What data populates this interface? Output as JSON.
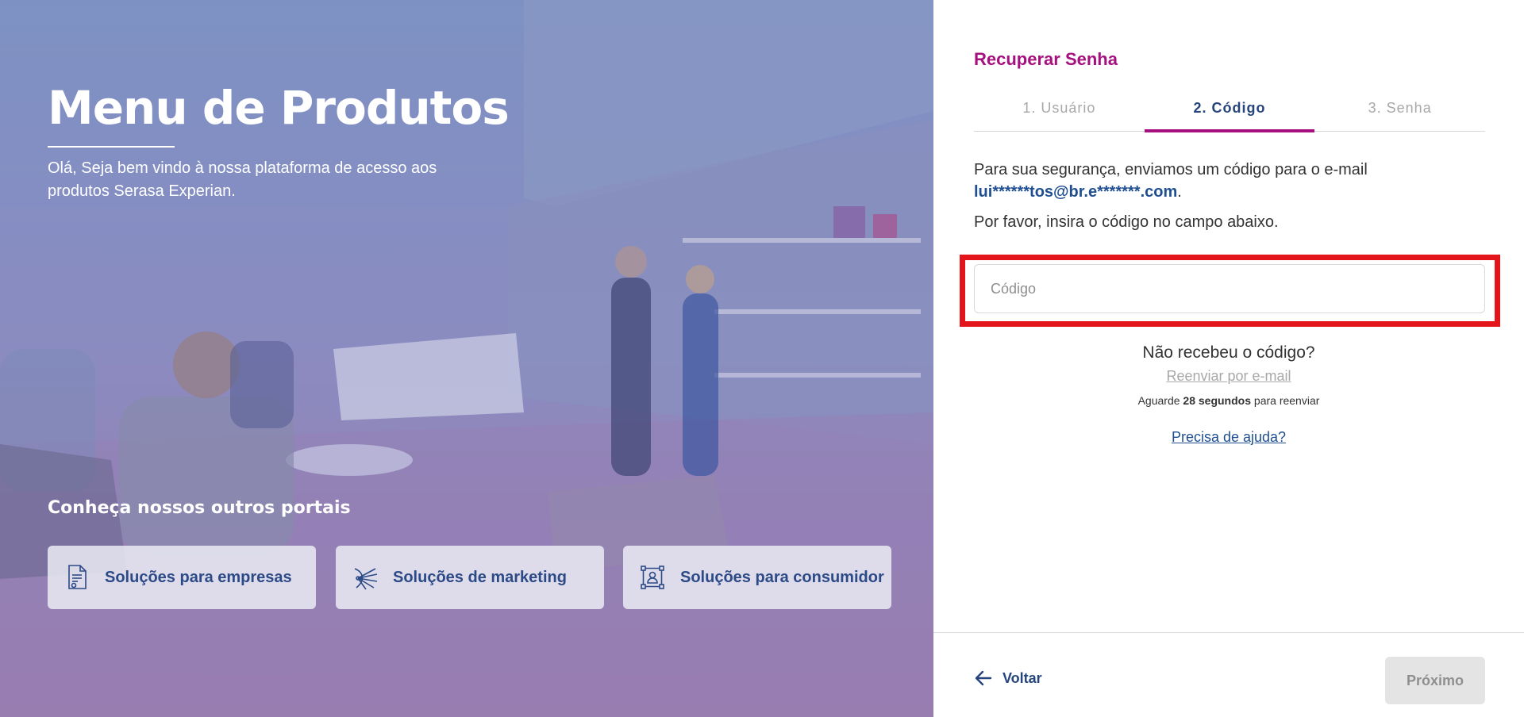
{
  "hero": {
    "title": "Menu de Produtos",
    "subtitle": "Olá, Seja bem vindo à nossa plataforma de acesso aos produtos Serasa Experian.",
    "portals_title": "Conheça nossos outros portais",
    "portals": [
      {
        "label": "Soluções para empresas",
        "icon": "document-icon"
      },
      {
        "label": "Soluções de marketing",
        "icon": "network-icon"
      },
      {
        "label": "Soluções para consumidor",
        "icon": "person-focus-icon"
      }
    ]
  },
  "form": {
    "title": "Recuperar Senha",
    "steps": [
      {
        "label": "1. Usuário",
        "active": false
      },
      {
        "label": "2. Código",
        "active": true
      },
      {
        "label": "3. Senha",
        "active": false
      }
    ],
    "message_prefix": "Para sua segurança, enviamos um código para o e-mail",
    "email": "lui******tos@br.e*******.com",
    "message_suffix": ".",
    "instruction": "Por favor, insira o código no campo abaixo.",
    "code_placeholder": "Código",
    "code_value": "",
    "not_received": "Não recebeu o código?",
    "resend_label": "Reenviar por e-mail",
    "wait_prefix": "Aguarde",
    "wait_time": "28 segundos",
    "wait_suffix": "para reenviar",
    "help_label": "Precisa de ajuda?",
    "back_label": "Voltar",
    "next_label": "Próximo"
  },
  "colors": {
    "brand_magenta": "#a6107e",
    "brand_blue": "#26457d",
    "highlight_red": "#e4141b"
  }
}
